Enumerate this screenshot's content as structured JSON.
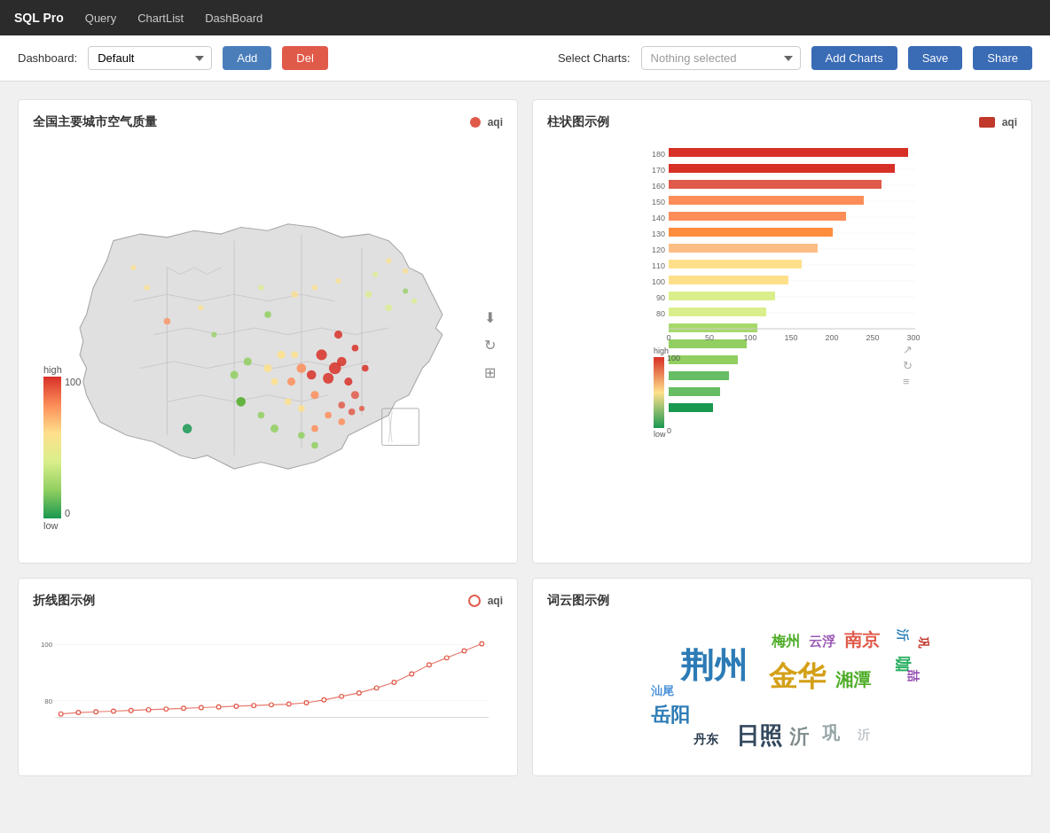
{
  "nav": {
    "brand": "SQL Pro",
    "items": [
      "Query",
      "ChartList",
      "DashBoard"
    ]
  },
  "toolbar": {
    "dashboard_label": "Dashboard:",
    "dashboard_default": "Default",
    "add_label": "Add",
    "del_label": "Del",
    "select_charts_label": "Select Charts:",
    "nothing_selected": "Nothing selected",
    "add_charts_label": "Add Charts",
    "save_label": "Save",
    "share_label": "Share"
  },
  "map_chart": {
    "title": "全国主要城市空气质量",
    "legend_label": "aqi",
    "legend_color": "#e05a4a",
    "scale_high": "high",
    "scale_100": "100",
    "scale_0": "0",
    "scale_low": "low"
  },
  "bar_chart": {
    "title": "柱状图示例",
    "legend_label": "aqi",
    "legend_color": "#c0392b",
    "scale_high": "high",
    "scale_100": "100",
    "scale_low": "low",
    "scale_0": "0",
    "x_labels": [
      "0",
      "50",
      "100",
      "150",
      "200",
      "250",
      "300"
    ],
    "y_labels": [
      "180",
      "170",
      "160",
      "150",
      "140",
      "130",
      "120",
      "110",
      "100",
      "90",
      "80"
    ]
  },
  "line_chart": {
    "title": "折线图示例",
    "legend_label": "aqi",
    "y_labels": [
      "100",
      "80"
    ],
    "color": "#e05a4a"
  },
  "word_cloud": {
    "title": "词云图示例",
    "words": [
      {
        "text": "荆州",
        "size": 38,
        "color": "#2c7bb6"
      },
      {
        "text": "梅州",
        "size": 18,
        "color": "#4dac26"
      },
      {
        "text": "云浮",
        "size": 16,
        "color": "#d01c8b"
      },
      {
        "text": "南京",
        "size": 22,
        "color": "#e05a4a"
      },
      {
        "text": "汕尾",
        "size": 14,
        "color": "#4a90d9"
      },
      {
        "text": "金华",
        "size": 34,
        "color": "#d4a017"
      },
      {
        "text": "岳阳",
        "size": 22,
        "color": "#2c7bb6"
      },
      {
        "text": "湘潭",
        "size": 20,
        "color": "#4dac26"
      },
      {
        "text": "丹东",
        "size": 14,
        "color": "#3a3a3a"
      },
      {
        "text": "日照",
        "size": 28,
        "color": "#4a4a4a"
      },
      {
        "text": "沂",
        "size": 24,
        "color": "#888"
      },
      {
        "text": "巩",
        "size": 16,
        "color": "#aaa"
      },
      {
        "text": "咖",
        "size": 14,
        "color": "#666"
      }
    ]
  }
}
